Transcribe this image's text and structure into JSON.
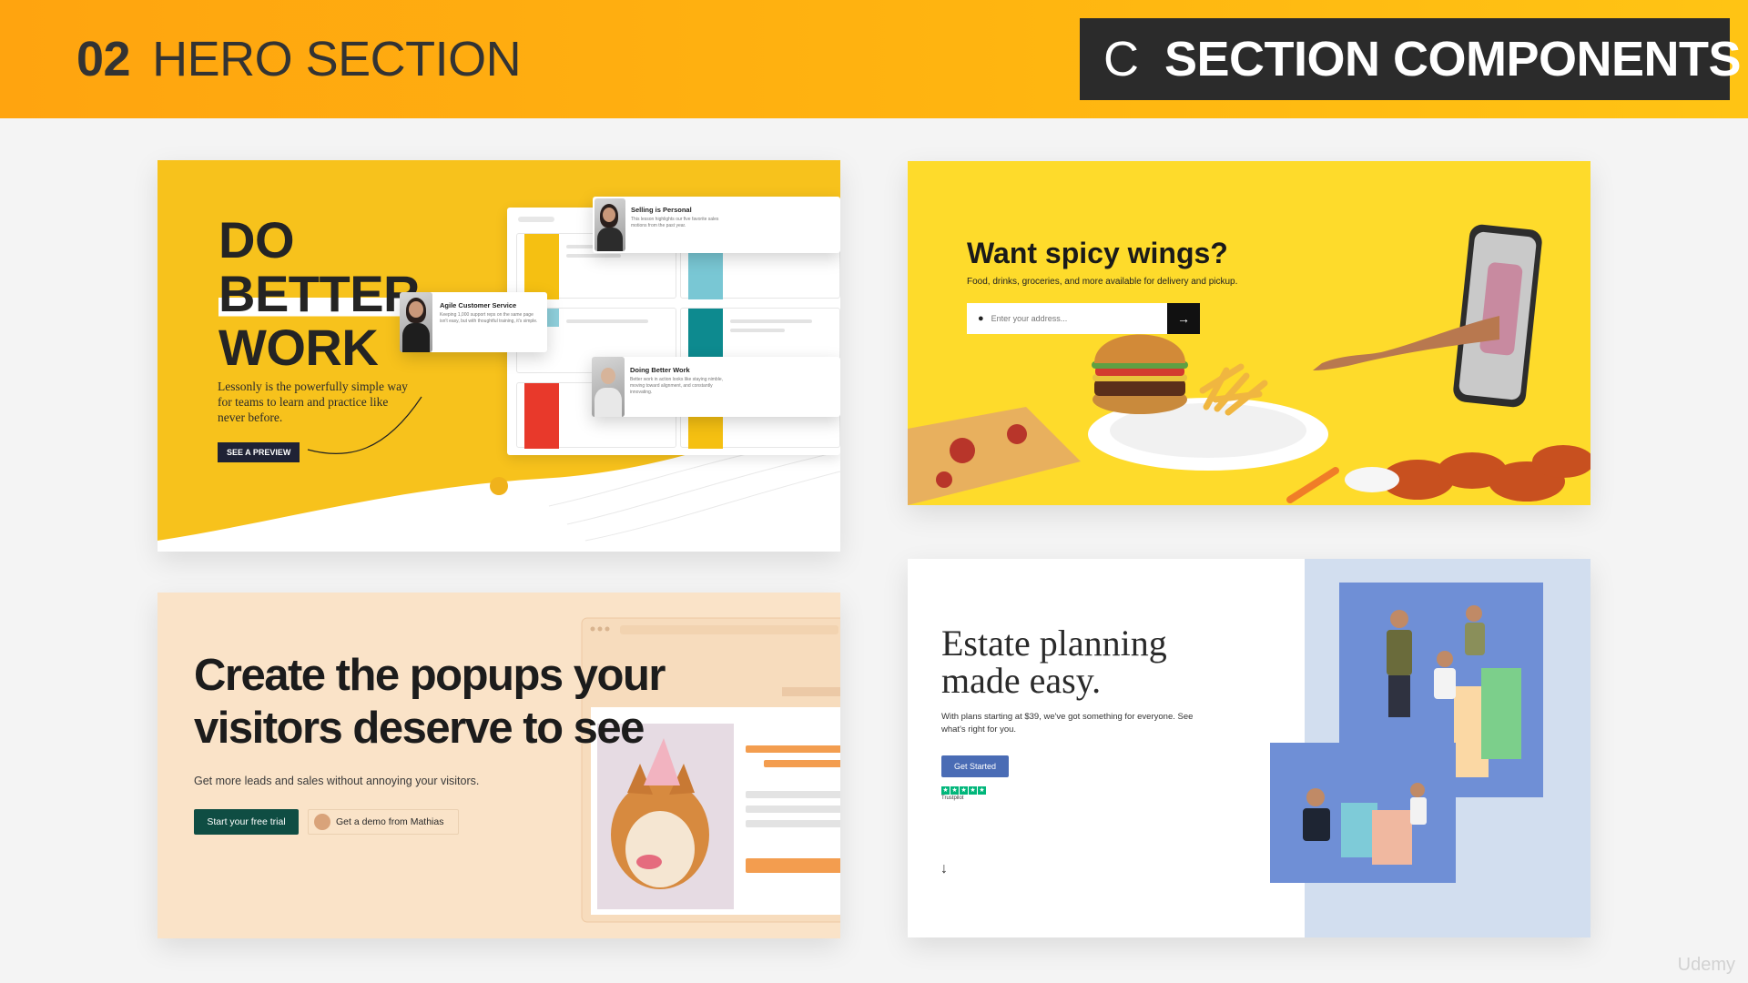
{
  "header": {
    "section_number": "02",
    "section_name": "HERO SECTION",
    "badge_letter": "C",
    "badge_text": "SECTION COMPONENTS"
  },
  "card1": {
    "headline": [
      "DO",
      "BETTER",
      "WORK"
    ],
    "subtext": "Lessonly is the powerfully simple way for teams to learn and practice like never before.",
    "cta": "SEE A PREVIEW",
    "popup_selling_title": "Selling is Personal",
    "popup_selling_text": "This lesson highlights our five favorite sales motions from the past year.",
    "popup_agile_title": "Agile Customer Service",
    "popup_agile_text": "Keeping 1,000 support reps on the same page isn't easy, but with thoughtful training, it's simple.",
    "popup_doing_title": "Doing Better Work",
    "popup_doing_text": "Better work in action looks like staying nimble, moving toward alignment, and constantly innovating.",
    "accent": "#f7c21c"
  },
  "card2": {
    "title": "Want spicy wings?",
    "subtitle": "Food, drinks, groceries, and more available for delivery and pickup.",
    "address_placeholder": "Enter your address...",
    "submit_icon": "arrow-right-icon",
    "accent": "#fedb2b"
  },
  "card3": {
    "headline": [
      "Create the popups your",
      "visitors deserve to see"
    ],
    "subtext": "Get more leads and sales without annoying your visitors.",
    "primary_cta": "Start your free trial",
    "secondary_cta": "Get a demo from Mathias",
    "accent": "#0f4d43"
  },
  "card4": {
    "headline": [
      "Estate planning",
      "made easy."
    ],
    "subtext": "With plans starting at $39, we've got something for everyone. See what's right for you.",
    "cta": "Get Started",
    "rating_label": "Trustpilot",
    "scroll_icon": "arrow-down-icon",
    "accent": "#4a6cb5"
  },
  "watermark": "Udemy"
}
